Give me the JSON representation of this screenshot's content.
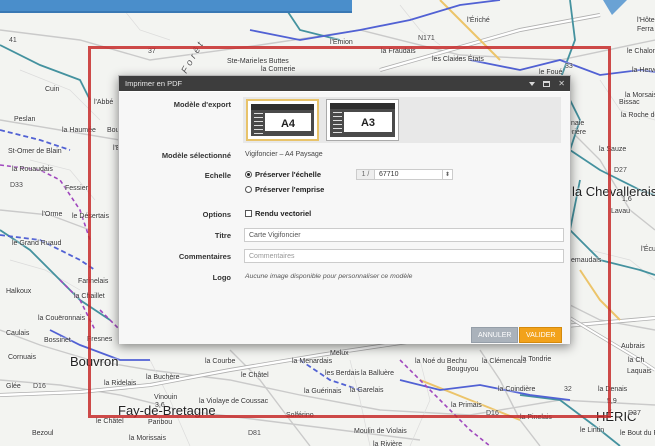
{
  "map": {
    "places": [
      {
        "t": "41",
        "c": "road"
      },
      {
        "t": "37",
        "c": "road"
      },
      {
        "t": "Ste-Marie",
        "c": ""
      },
      {
        "t": "les Buttes",
        "c": ""
      },
      {
        "t": "la Cornerie",
        "c": ""
      },
      {
        "t": "Forêt",
        "c": "mid"
      },
      {
        "t": "l'Emion",
        "c": ""
      },
      {
        "t": "la Fraudais",
        "c": ""
      },
      {
        "t": "les Claies",
        "c": ""
      },
      {
        "t": "les États",
        "c": ""
      },
      {
        "t": "N171",
        "c": "road"
      },
      {
        "t": "l'Ériché",
        "c": ""
      },
      {
        "t": "l'Hôte",
        "c": ""
      },
      {
        "t": "Ferra",
        "c": ""
      },
      {
        "t": "le Chalonge",
        "c": ""
      },
      {
        "t": "la Hervoie",
        "c": ""
      },
      {
        "t": "le Foué",
        "c": ""
      },
      {
        "t": "33",
        "c": "road"
      },
      {
        "t": "Cuin",
        "c": ""
      },
      {
        "t": "l'Abbé",
        "c": ""
      },
      {
        "t": "Peslan",
        "c": ""
      },
      {
        "t": "la Haumée",
        "c": ""
      },
      {
        "t": "Bougard",
        "c": ""
      },
      {
        "t": "St-Omer de Blain",
        "c": ""
      },
      {
        "t": "la Rouaudais",
        "c": ""
      },
      {
        "t": "D33",
        "c": "road"
      },
      {
        "t": "Fessier",
        "c": ""
      },
      {
        "t": "l'Orme",
        "c": ""
      },
      {
        "t": "le Désertais",
        "c": ""
      },
      {
        "t": "le Grand Ruaud",
        "c": ""
      },
      {
        "t": "Halkoux",
        "c": ""
      },
      {
        "t": "Farinelais",
        "c": ""
      },
      {
        "t": "la Chaillet",
        "c": ""
      },
      {
        "t": "la Couëronnais",
        "c": ""
      },
      {
        "t": "Caulais",
        "c": ""
      },
      {
        "t": "Bossinet",
        "c": ""
      },
      {
        "t": "Fresnes",
        "c": ""
      },
      {
        "t": "Cornuais",
        "c": ""
      },
      {
        "t": "Bouvron",
        "c": "big"
      },
      {
        "t": "Glée",
        "c": ""
      },
      {
        "t": "D16",
        "c": "road"
      },
      {
        "t": "la Ridelais",
        "c": ""
      },
      {
        "t": "la Buchère",
        "c": ""
      },
      {
        "t": "Vinouin",
        "c": ""
      },
      {
        "t": "3,6",
        "c": ""
      },
      {
        "t": "Fay-de-Bretagne",
        "c": "big"
      },
      {
        "t": "la Violaye de Coussac",
        "c": ""
      },
      {
        "t": "le Châtel",
        "c": ""
      },
      {
        "t": "Paribou",
        "c": ""
      },
      {
        "t": "Bezoul",
        "c": ""
      },
      {
        "t": "la Morissais",
        "c": ""
      },
      {
        "t": "la Courbe",
        "c": ""
      },
      {
        "t": "le Châtel",
        "c": ""
      },
      {
        "t": "la Menardais",
        "c": ""
      },
      {
        "t": "Melux",
        "c": ""
      },
      {
        "t": "les Berdais",
        "c": ""
      },
      {
        "t": "la Balluère",
        "c": ""
      },
      {
        "t": "la Guérinais",
        "c": ""
      },
      {
        "t": "la Garelais",
        "c": ""
      },
      {
        "t": "Solférino",
        "c": ""
      },
      {
        "t": "D81",
        "c": "road"
      },
      {
        "t": "Moulin de Violais",
        "c": ""
      },
      {
        "t": "la Rivière",
        "c": ""
      },
      {
        "t": "la Noé du Bechu",
        "c": ""
      },
      {
        "t": "Bouguyou",
        "c": ""
      },
      {
        "t": "la Clémencais",
        "c": ""
      },
      {
        "t": "la Tondrie",
        "c": ""
      },
      {
        "t": "la Coindière",
        "c": ""
      },
      {
        "t": "la Primais",
        "c": ""
      },
      {
        "t": "D16",
        "c": "road"
      },
      {
        "t": "la Pinelais",
        "c": ""
      },
      {
        "t": "le Lintin",
        "c": ""
      },
      {
        "t": "32",
        "c": "road"
      },
      {
        "t": "la Denais",
        "c": ""
      },
      {
        "t": "5,9",
        "c": ""
      },
      {
        "t": "HÉRIC",
        "c": "big"
      },
      {
        "t": "le Bout du Pavé",
        "c": ""
      },
      {
        "t": "la Chevallerais",
        "c": "big"
      },
      {
        "t": "1,6",
        "c": ""
      },
      {
        "t": "Lavau",
        "c": ""
      },
      {
        "t": "D27",
        "c": "road"
      },
      {
        "t": "la Sauze",
        "c": ""
      },
      {
        "t": "la Morsais",
        "c": ""
      },
      {
        "t": "Bissac",
        "c": ""
      },
      {
        "t": "la Roche des",
        "c": ""
      },
      {
        "t": "naie",
        "c": ""
      },
      {
        "t": "rière",
        "c": ""
      },
      {
        "t": "emaudais",
        "c": ""
      },
      {
        "t": "l'Écu",
        "c": ""
      },
      {
        "t": "Aubrais",
        "c": ""
      },
      {
        "t": "la Ch",
        "c": ""
      },
      {
        "t": "Laquais",
        "c": ""
      },
      {
        "t": "D37",
        "c": "road"
      },
      {
        "t": "l'Esdr",
        "c": ""
      },
      {
        "t": "la R",
        "c": ""
      }
    ]
  },
  "dialog": {
    "title": "Imprimer en PDF",
    "model_label": "Modèle d'export",
    "models": [
      {
        "label": "A4",
        "selected": true
      },
      {
        "label": "A3",
        "selected": false
      }
    ],
    "selected_label": "Modèle sélectionné",
    "selected_value": "Vigifoncier – A4 Paysage",
    "scale_label": "Echelle",
    "scale_option_1": "Préserver l'échelle",
    "scale_prefix": "1 /",
    "scale_value": "67710",
    "scale_option_2": "Préserver l'emprise",
    "options_label": "Options",
    "vector_label": "Rendu vectoriel",
    "title_label": "Titre",
    "title_value": "Carte Vigifoncier",
    "comments_label": "Commentaires",
    "comments_placeholder": "Commentaires",
    "logo_label": "Logo",
    "logo_text": "Aucune image disponible pour personnaliser ce modèle",
    "cancel": "ANNULER",
    "ok": "VALIDER"
  },
  "colors": {
    "accent": "#f2a21b",
    "frame": "#c62a2a",
    "titlebar": "#3d3d3d"
  }
}
